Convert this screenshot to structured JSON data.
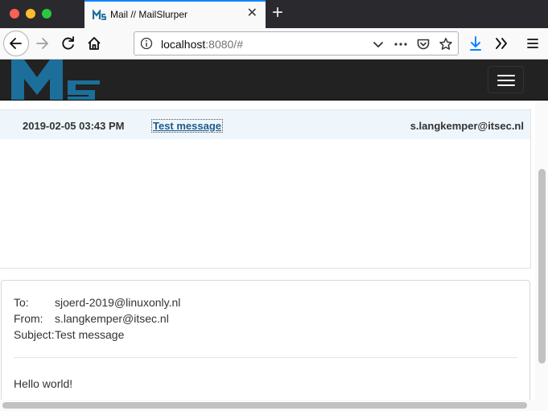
{
  "browser": {
    "tab": {
      "title": "Mail // MailSlurper",
      "favicon": "mailslurper-logo-icon",
      "close_icon": "close-icon"
    },
    "new_tab_icon": "plus-icon",
    "toolbar": {
      "back_icon": "arrow-left-icon",
      "forward_icon": "arrow-right-icon",
      "reload_icon": "reload-icon",
      "home_icon": "home-icon",
      "info_icon": "info-icon",
      "url_host": "localhost",
      "url_rest": ":8080/#",
      "dropdown_icon": "chevron-down-icon",
      "more_icon": "ellipsis-icon",
      "pocket_icon": "pocket-icon",
      "bookmark_icon": "star-icon",
      "downloads_icon": "download-icon",
      "overflow_icon": "double-chevron-icon",
      "menu_icon": "hamburger-menu-icon"
    }
  },
  "app": {
    "logo_icon": "mailslurper-ms-logo",
    "menu_toggle_icon": "hamburger-menu-icon",
    "colors": {
      "navbar": "#222222",
      "logo": "#1b6f9a",
      "row_selected": "#eef6fc",
      "link": "#1d5a8a"
    },
    "messages": [
      {
        "date": "2019-02-05 03:43 PM",
        "subject": "Test message",
        "from": "s.langkemper@itsec.nl"
      }
    ],
    "detail": {
      "to_label": "To:",
      "to_value": "sjoerd-2019@linuxonly.nl",
      "from_label": "From:",
      "from_value": "s.langkemper@itsec.nl",
      "subject_label": "Subject:",
      "subject_value": "Test message",
      "body": "Hello world!"
    }
  }
}
